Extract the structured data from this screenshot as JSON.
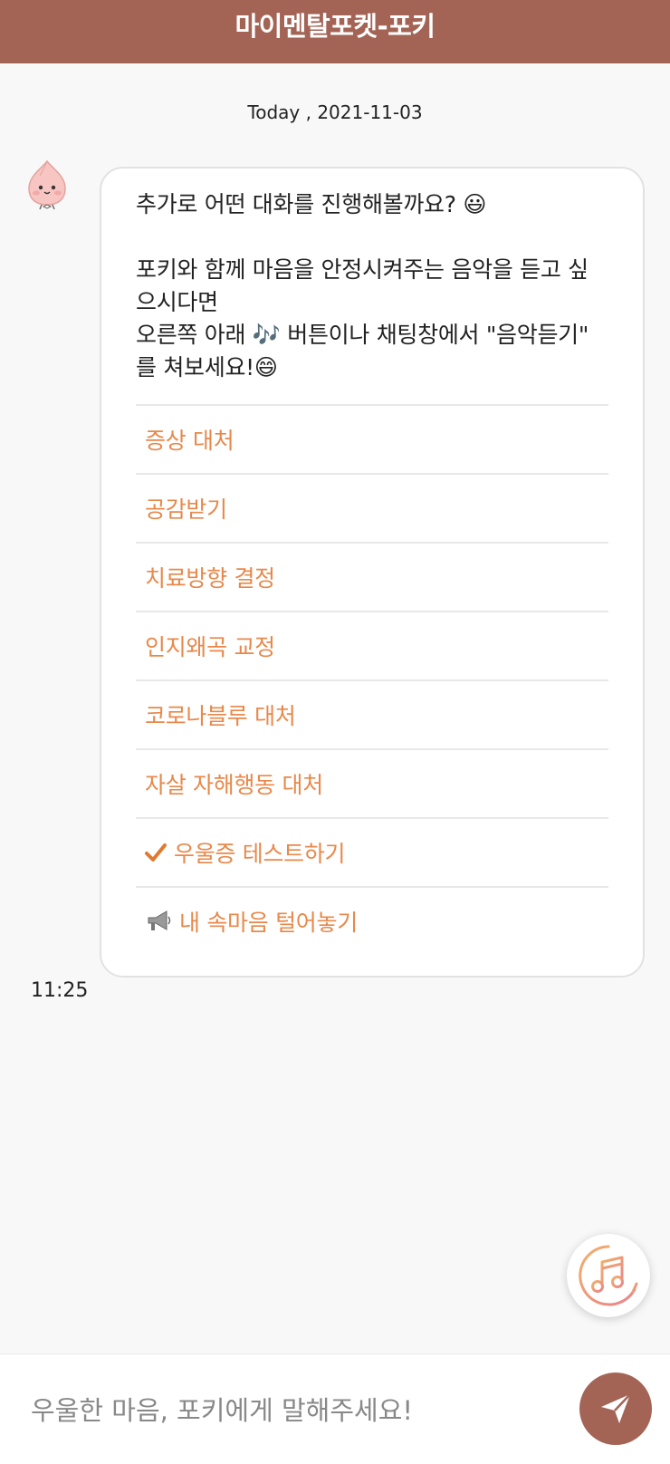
{
  "header": {
    "title": "마이멘탈포켓-포키"
  },
  "chat": {
    "date": "Today , 2021-11-03",
    "message": {
      "text": "추가로 어떤 대화를 진행해볼까요? 😃\n\n포키와 함께 마음을 안정시켜주는 음악을 듣고 싶으시다면\n오른쪽 아래 🎶 버튼이나 채팅창에서 \"음악듣기\" 를 쳐보세요!😄",
      "time": "11:25",
      "options": [
        {
          "label": "증상 대처"
        },
        {
          "label": "공감받기"
        },
        {
          "label": "치료방향 결정"
        },
        {
          "label": "인지왜곡 교정"
        },
        {
          "label": "코로나블루 대처"
        },
        {
          "label": "자살 자해행동 대처"
        },
        {
          "label": "우울증 테스트하기",
          "icon": "checkmark-icon"
        },
        {
          "label": "내 속마음 털어놓기",
          "icon": "megaphone-icon"
        }
      ]
    }
  },
  "input": {
    "placeholder": "우울한 마음, 포키에게 말해주세요!"
  },
  "colors": {
    "header_bg": "#a36456",
    "option_text": "#e8884a",
    "send_button": "#a36456"
  }
}
